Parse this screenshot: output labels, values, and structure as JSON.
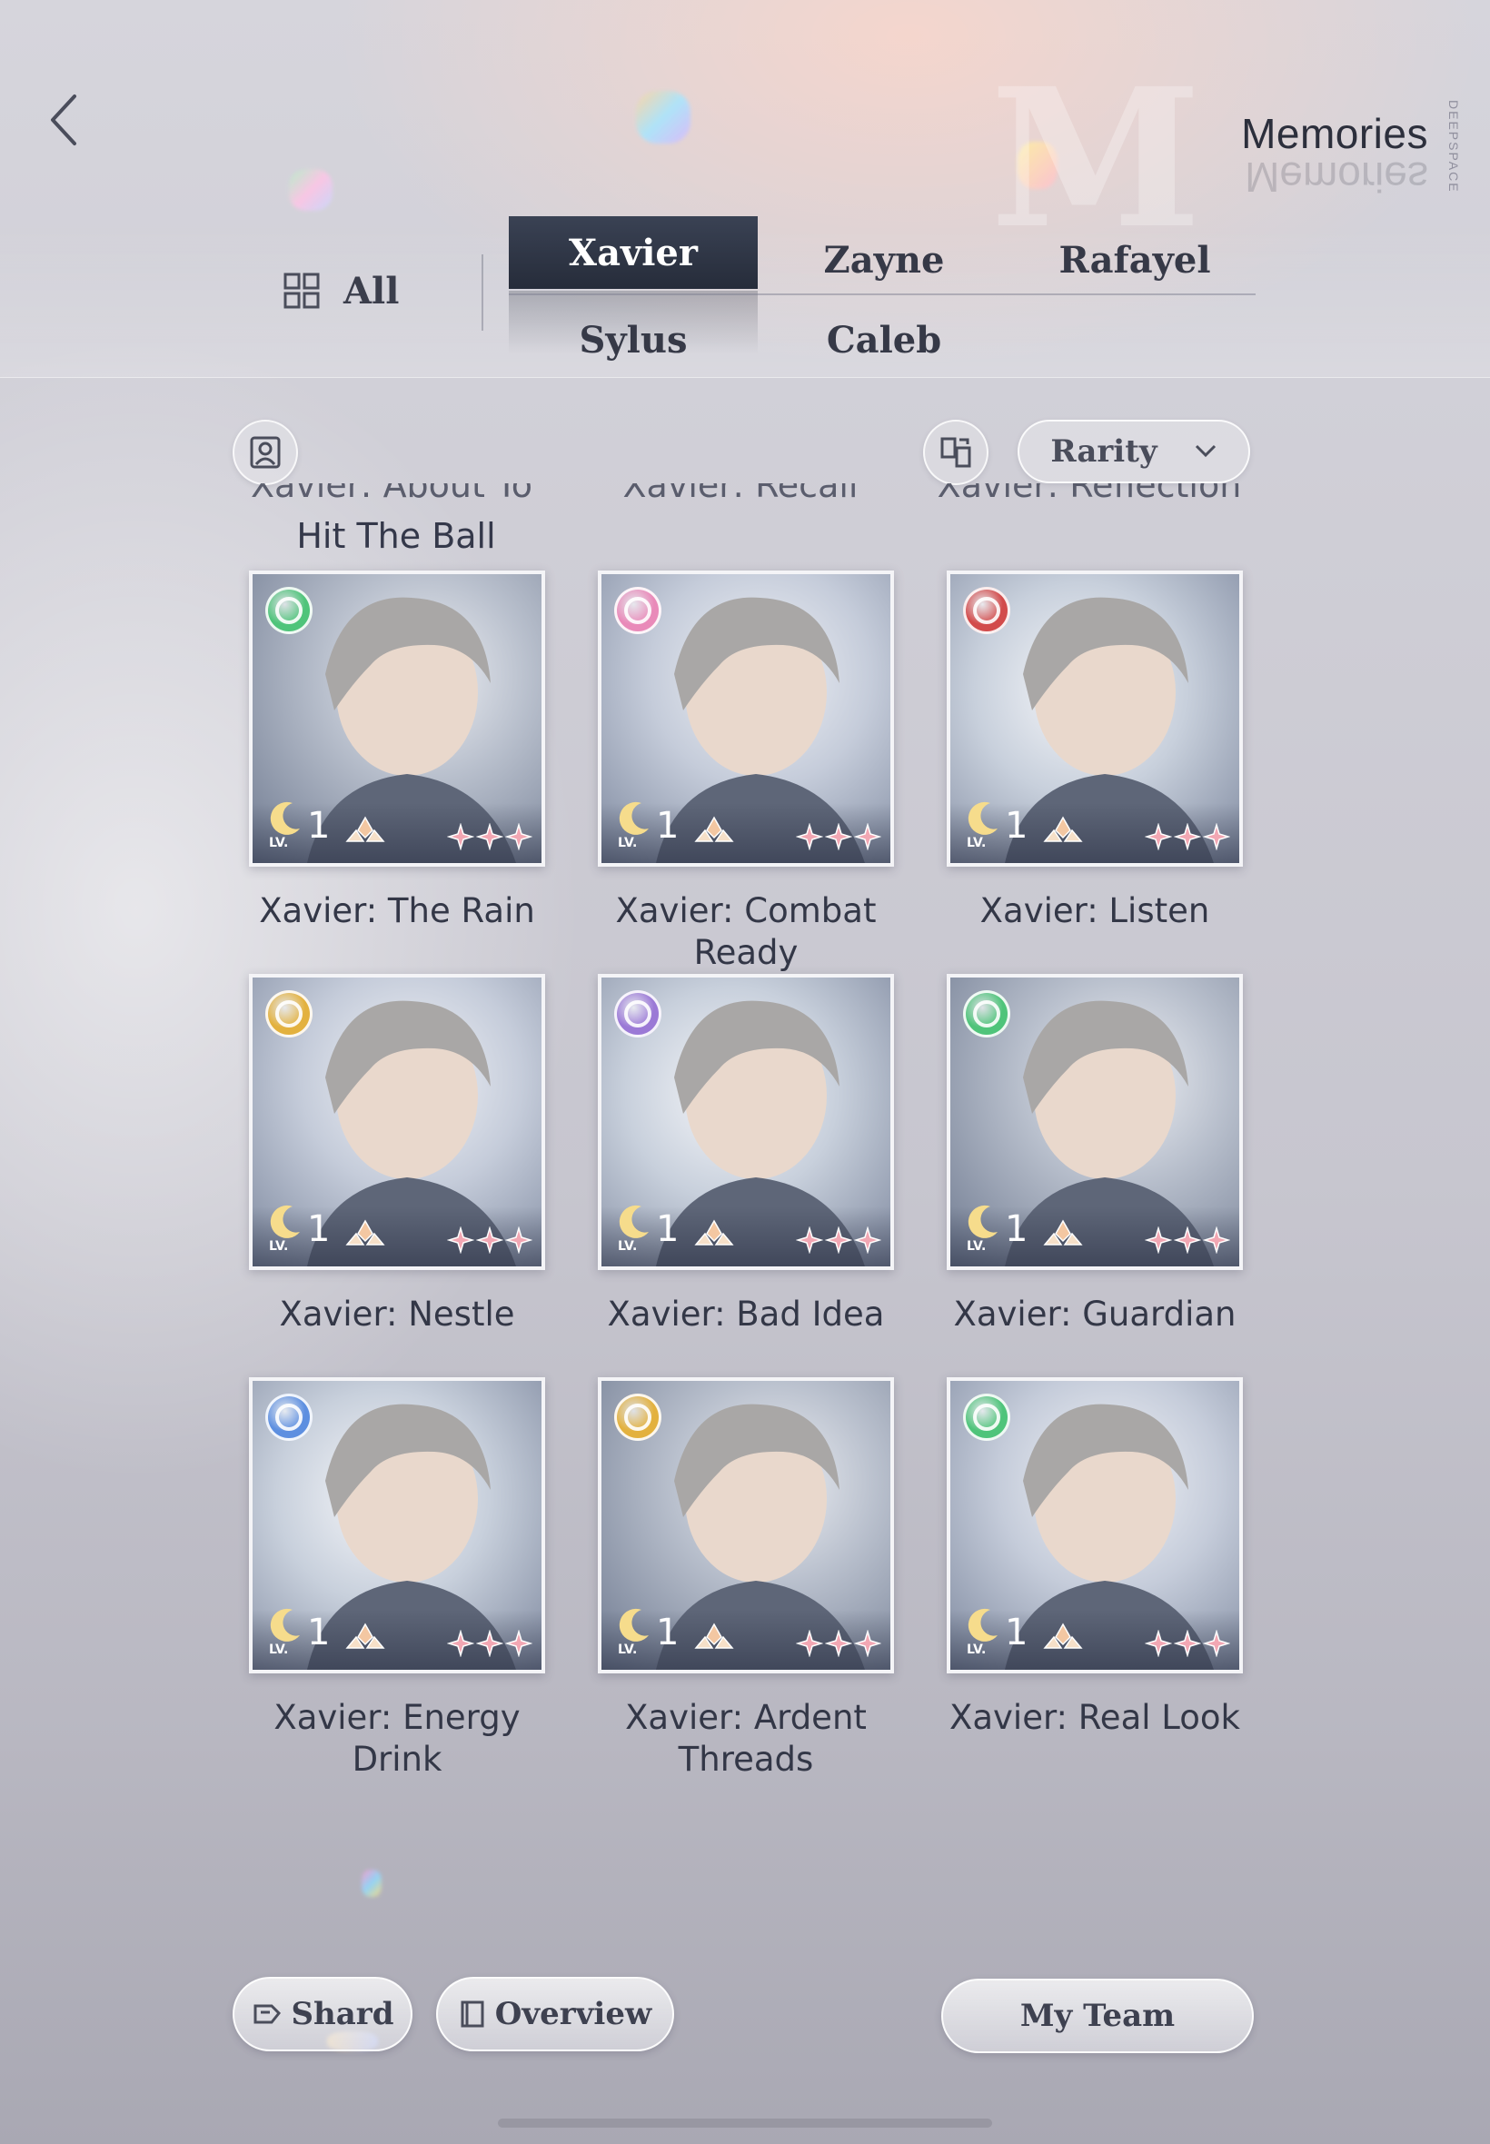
{
  "header": {
    "title": "Memories",
    "side_text": "DEEPSPACE"
  },
  "tabs": {
    "all_label": "All",
    "characters": [
      {
        "label": "Xavier",
        "active": true
      },
      {
        "label": "Zayne",
        "active": false
      },
      {
        "label": "Rafayel",
        "active": false
      },
      {
        "label": "Sylus",
        "active": false
      },
      {
        "label": "Caleb",
        "active": false
      }
    ]
  },
  "toolbar": {
    "sort_label": "Rarity"
  },
  "partial_row": {
    "titles": [
      "Xavier: About To",
      "Xavier: Recall",
      "Xavier: Reflection"
    ],
    "first_title_line2": "Hit The Ball"
  },
  "cards": [
    {
      "title": "Xavier: The Rain",
      "level": "1",
      "lv_tag": "LV.",
      "gem_color": "#4fc47a",
      "stars": 3
    },
    {
      "title": "Xavier: Combat Ready",
      "level": "1",
      "lv_tag": "LV.",
      "gem_color": "#e98ab9",
      "stars": 3
    },
    {
      "title": "Xavier: Listen",
      "level": "1",
      "lv_tag": "LV.",
      "gem_color": "#d24b4b",
      "stars": 3
    },
    {
      "title": "Xavier: Nestle",
      "level": "1",
      "lv_tag": "LV.",
      "gem_color": "#e3b13e",
      "stars": 3
    },
    {
      "title": "Xavier: Bad Idea",
      "level": "1",
      "lv_tag": "LV.",
      "gem_color": "#9b79d6",
      "stars": 3
    },
    {
      "title": "Xavier: Guardian",
      "level": "1",
      "lv_tag": "LV.",
      "gem_color": "#4fc47a",
      "stars": 3
    },
    {
      "title": "Xavier: Energy Drink",
      "level": "1",
      "lv_tag": "LV.",
      "gem_color": "#5d8fe0",
      "stars": 3
    },
    {
      "title": "Xavier: Ardent Threads",
      "level": "1",
      "lv_tag": "LV.",
      "gem_color": "#e3b13e",
      "stars": 3
    },
    {
      "title": "Xavier: Real Look",
      "level": "1",
      "lv_tag": "LV.",
      "gem_color": "#4fc47a",
      "stars": 3
    }
  ],
  "bottom_bar": {
    "shard_label": "Shard",
    "overview_label": "Overview",
    "team_label": "My Team"
  },
  "icons": {
    "back": "chevron-left-icon",
    "all": "grid-icon",
    "profile_filter": "portrait-icon",
    "layout_toggle": "swap-icon",
    "dropdown": "chevron-down-icon",
    "shard": "shard-icon",
    "overview": "book-icon"
  },
  "colors": {
    "active_tab": "#2b3140",
    "text_dark": "#333747",
    "star_pink": "#f2a7b3"
  }
}
